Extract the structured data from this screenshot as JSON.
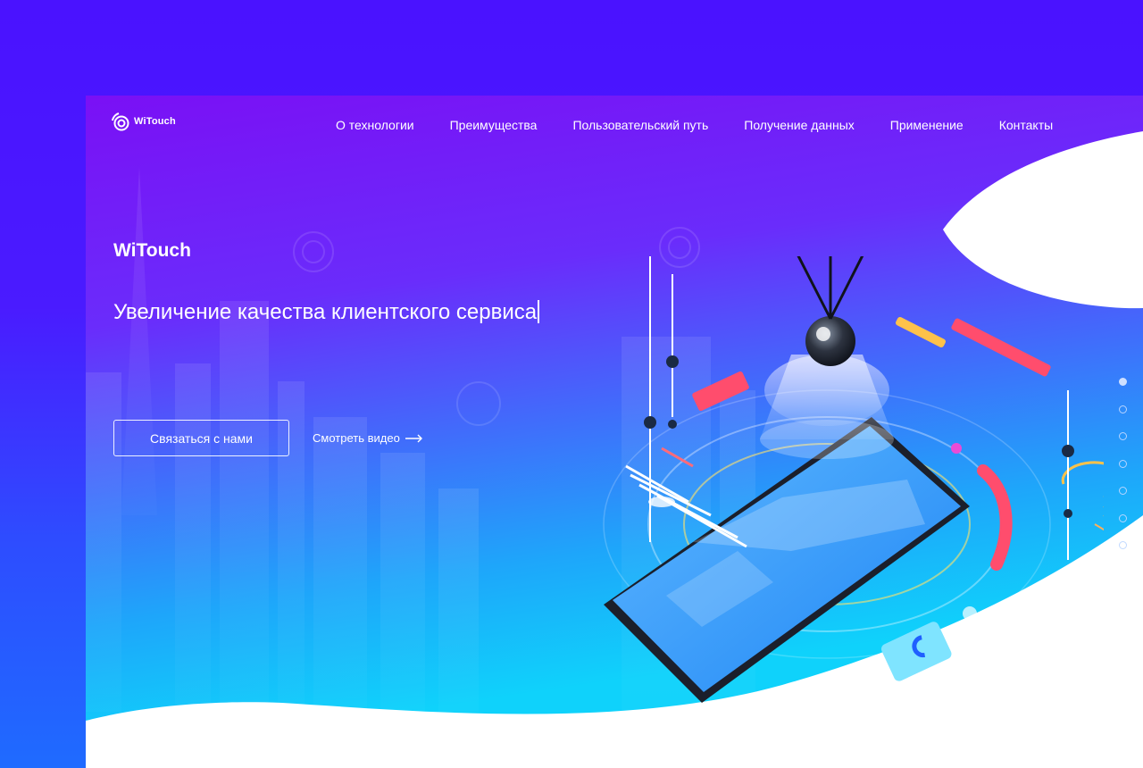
{
  "header": {
    "logo_text": "WiTouch",
    "nav": [
      {
        "label": "О технологии"
      },
      {
        "label": "Преимущества"
      },
      {
        "label": "Пользовательский путь"
      },
      {
        "label": "Получение данных"
      },
      {
        "label": "Применение"
      },
      {
        "label": "Контакты"
      }
    ]
  },
  "hero": {
    "brand": "WiTouch",
    "headline": "Увеличение качества клиентского сервиса",
    "contact_button": "Связаться с нами",
    "video_link": "Смотреть видео"
  },
  "pagination": {
    "count": 7,
    "active_index": 0
  },
  "colors": {
    "page_background": "#4a12ff",
    "hero_top": "#7a10f5",
    "hero_bottom": "#12cdfb",
    "accent_red": "#ff4d6d",
    "accent_yellow": "#ffc24a"
  },
  "icons": {
    "logo": "signal-ring-icon",
    "video_arrow": "arrow-right-icon",
    "illustration": "smartphone-wifi-beacon"
  }
}
